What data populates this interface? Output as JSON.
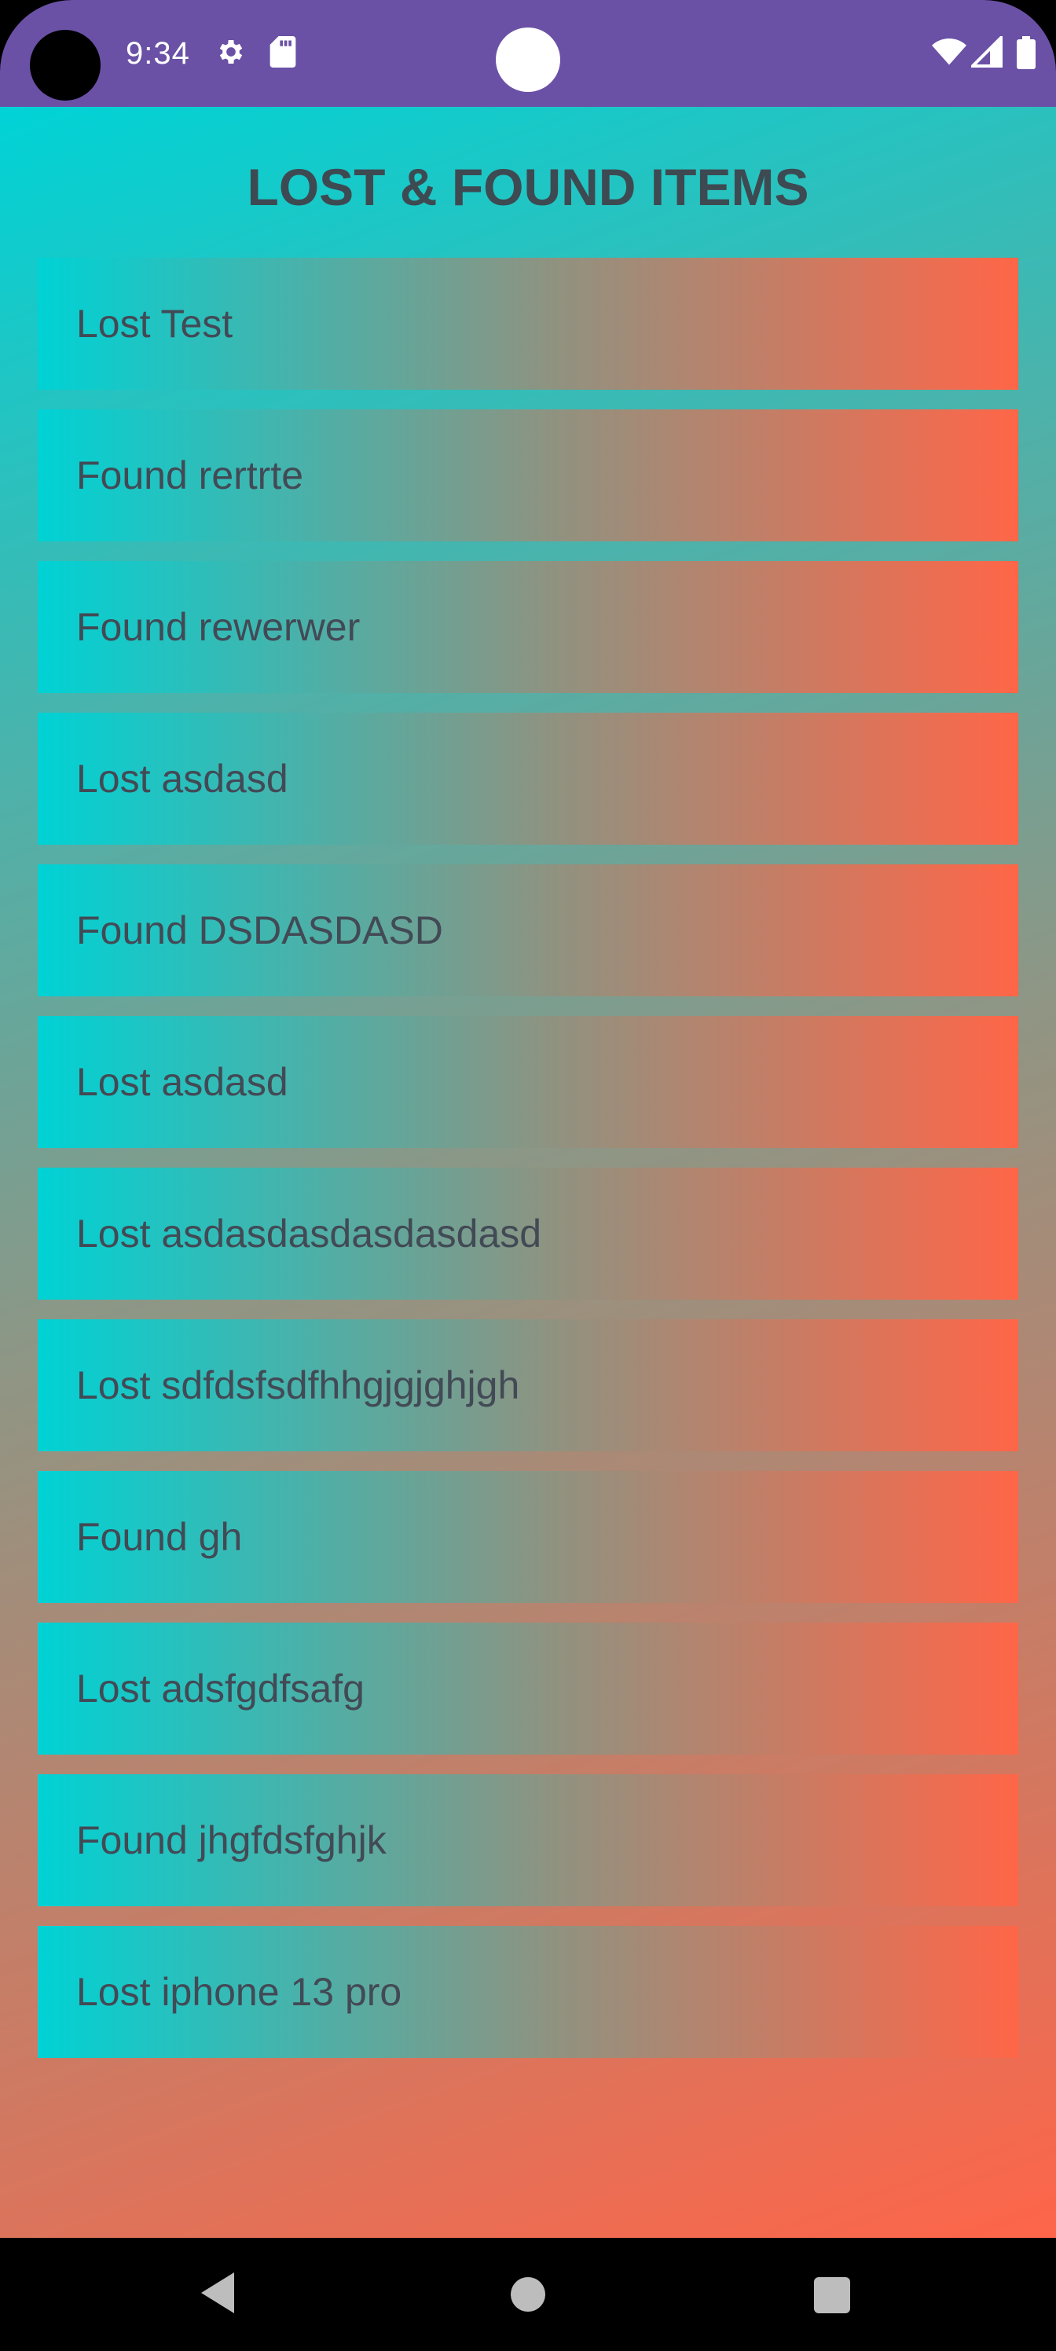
{
  "status_bar": {
    "time": "9:34",
    "left_icons": [
      "settings-gear-icon",
      "sd-card-icon"
    ],
    "right_icons": [
      "wifi-icon",
      "signal-icon",
      "battery-icon"
    ],
    "color": "#6a51a6"
  },
  "header": {
    "title": "LOST & FOUND ITEMS"
  },
  "items": [
    {
      "label": "Lost Test"
    },
    {
      "label": "Found rertrte"
    },
    {
      "label": "Found rewerwer"
    },
    {
      "label": "Lost asdasd"
    },
    {
      "label": "Found DSDASDASD"
    },
    {
      "label": "Lost asdasd"
    },
    {
      "label": "Lost asdasdasdasdasdasd"
    },
    {
      "label": "Lost sdfdsfsdfhhgjgjghjgh"
    },
    {
      "label": "Found gh"
    },
    {
      "label": "Lost adsfgdfsafg"
    },
    {
      "label": "Found jhgfdsfghjk"
    },
    {
      "label": "Lost iphone 13 pro"
    }
  ],
  "nav_bar": {
    "buttons": [
      "back-icon",
      "home-icon",
      "recents-icon"
    ]
  },
  "colors": {
    "gradient_start": "#00d3d6",
    "gradient_mid": "#8e9685",
    "gradient_end": "#fe6549",
    "text": "#424a55"
  }
}
